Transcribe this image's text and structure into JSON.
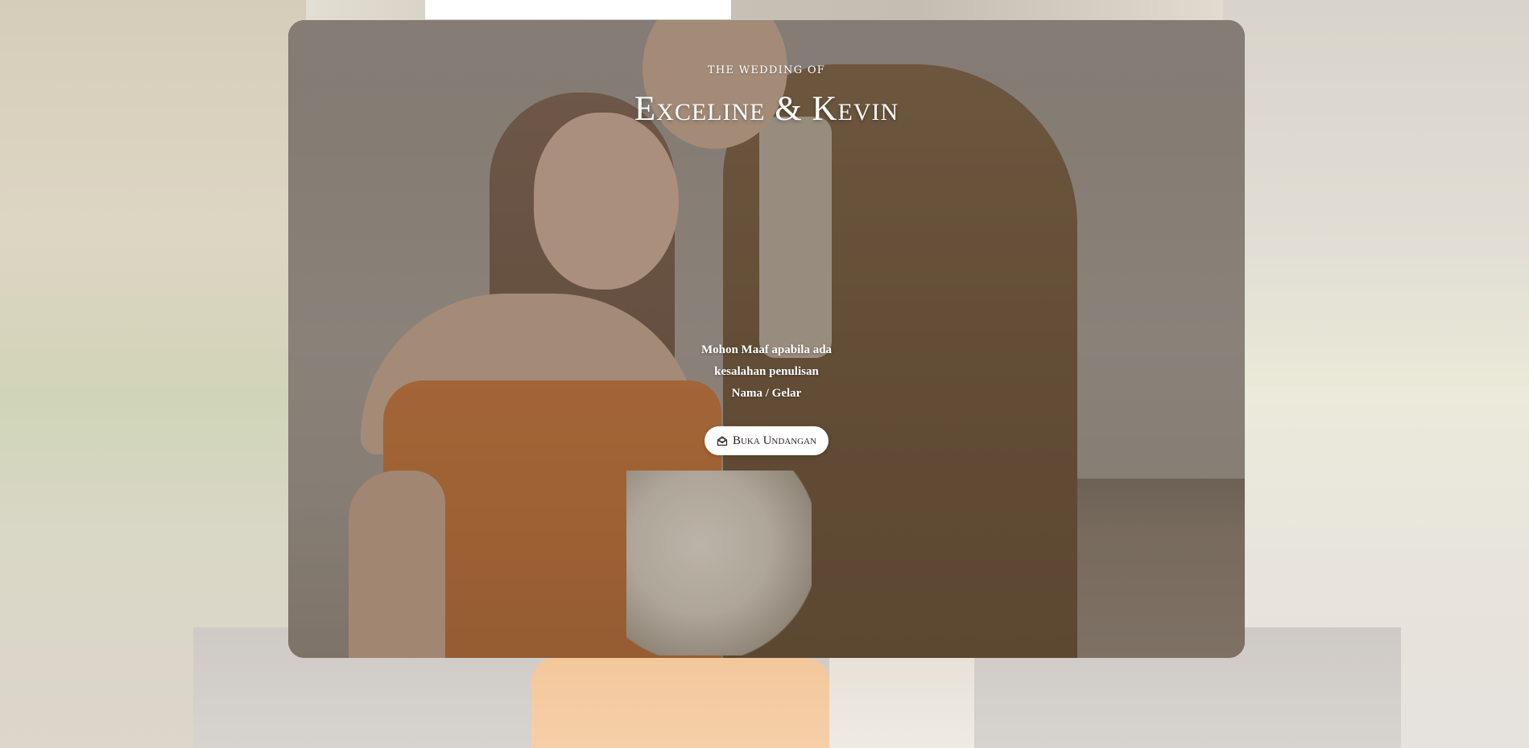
{
  "cover": {
    "kicker": "THE WEDDING OF",
    "couple_names": "Exceline & Kevin",
    "note_lines": [
      "Mohon Maaf apabila ada",
      "kesalahan penulisan",
      "Nama / Gelar"
    ],
    "open_button": {
      "label": "Buka Undangan",
      "icon": "envelope-open-icon"
    }
  },
  "colors": {
    "text": "#ffffff",
    "button_bg": "#ffffff",
    "button_text": "#2b2420",
    "card_overlay": "#8d857c"
  }
}
